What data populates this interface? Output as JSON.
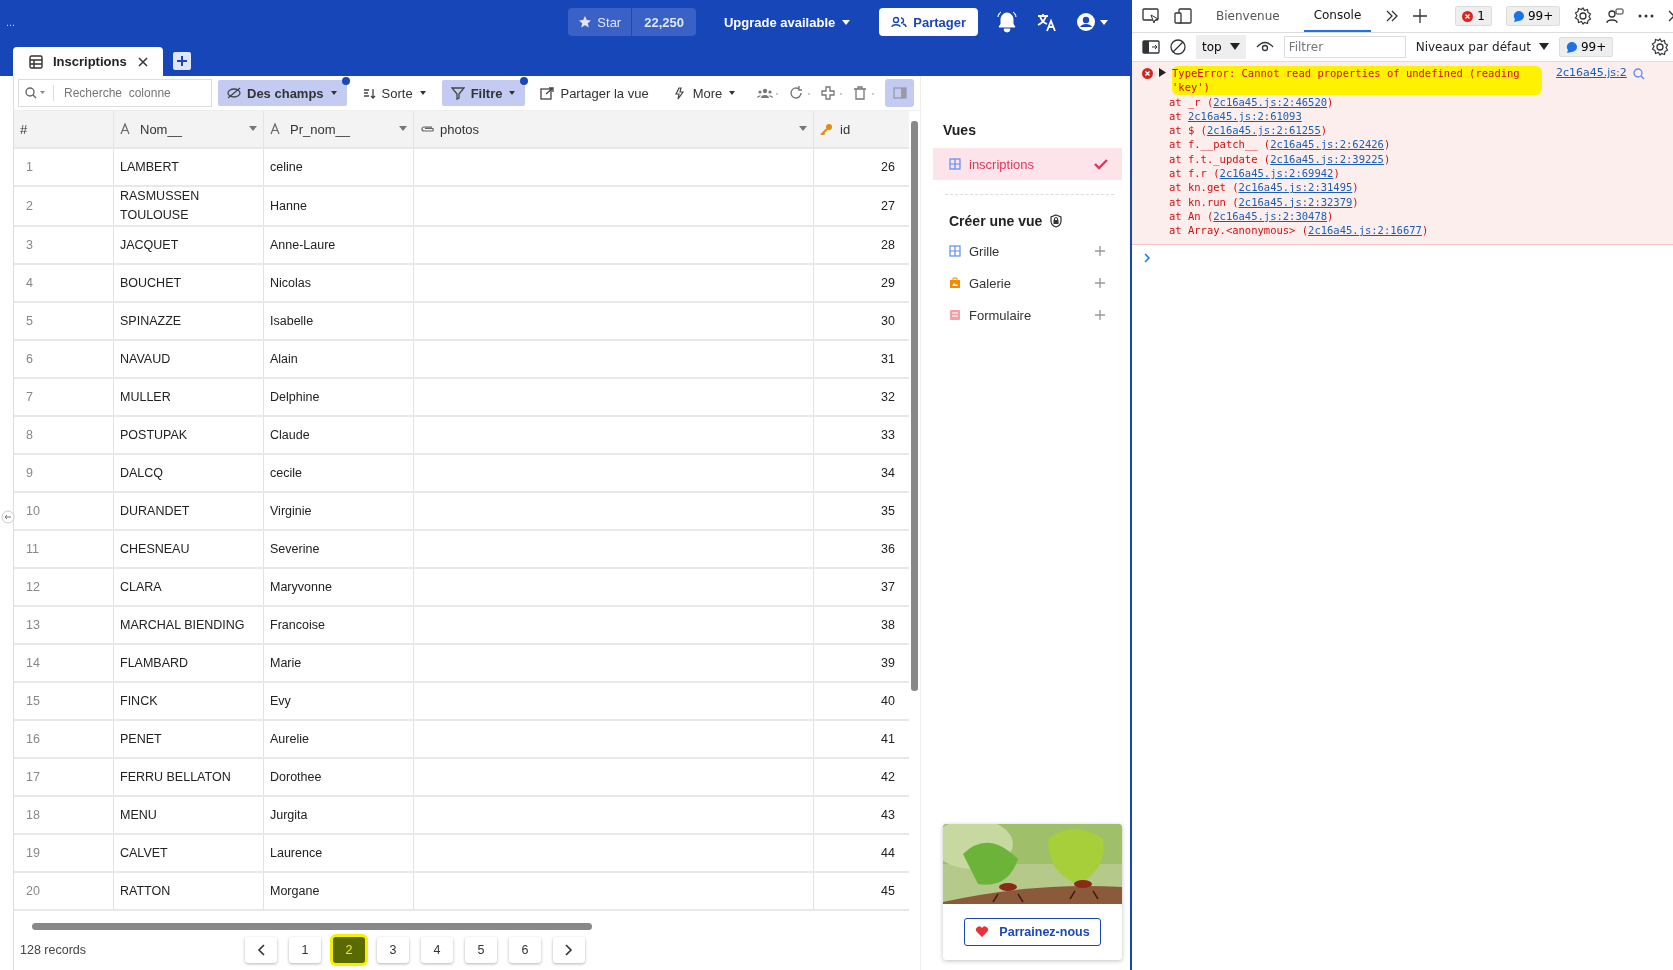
{
  "app": {
    "status_text": "...",
    "star": {
      "label": "Star",
      "count": "22,250"
    },
    "upgrade": "Upgrade available",
    "share": "Partager"
  },
  "tabs": [
    {
      "label": "Inscriptions",
      "selected": true
    }
  ],
  "toolbar": {
    "search": {
      "placeholder": "Recherche  colonne"
    },
    "buttons": [
      {
        "label": "Des champs",
        "kind": "fields",
        "active": true,
        "badge": true
      },
      {
        "label": "Sorte",
        "kind": "sort",
        "active": false,
        "badge": false
      },
      {
        "label": "Filtre",
        "kind": "filter",
        "active": true,
        "badge": true
      },
      {
        "label": "Partager la vue",
        "kind": "share",
        "active": false,
        "badge": false
      },
      {
        "label": "More",
        "kind": "more",
        "active": false,
        "badge": false
      }
    ]
  },
  "table": {
    "columns": [
      {
        "label": "#",
        "kind": "index"
      },
      {
        "label": "Nom__",
        "kind": "text"
      },
      {
        "label": "Pr_nom__",
        "kind": "text"
      },
      {
        "label": "photos",
        "kind": "attachment"
      },
      {
        "label": "id",
        "kind": "key"
      }
    ],
    "rows": [
      {
        "n": "1",
        "nom": "LAMBERT",
        "prenom": "celine",
        "id": "26"
      },
      {
        "n": "2",
        "nom": "RASMUSSEN TOULOUSE",
        "prenom": "Hanne",
        "id": "27"
      },
      {
        "n": "3",
        "nom": "JACQUET",
        "prenom": "Anne-Laure",
        "id": "28"
      },
      {
        "n": "4",
        "nom": "BOUCHET",
        "prenom": "Nicolas",
        "id": "29"
      },
      {
        "n": "5",
        "nom": "SPINAZZE",
        "prenom": "Isabelle",
        "id": "30"
      },
      {
        "n": "6",
        "nom": "NAVAUD",
        "prenom": "Alain",
        "id": "31"
      },
      {
        "n": "7",
        "nom": "MULLER",
        "prenom": "Delphine",
        "id": "32"
      },
      {
        "n": "8",
        "nom": "POSTUPAK",
        "prenom": "Claude",
        "id": "33"
      },
      {
        "n": "9",
        "nom": "DALCQ",
        "prenom": "cecile",
        "id": "34"
      },
      {
        "n": "10",
        "nom": "DURANDET",
        "prenom": "Virginie",
        "id": "35"
      },
      {
        "n": "11",
        "nom": "CHESNEAU",
        "prenom": "Severine",
        "id": "36"
      },
      {
        "n": "12",
        "nom": "CLARA",
        "prenom": "Maryvonne",
        "id": "37"
      },
      {
        "n": "13",
        "nom": "MARCHAL BIENDING",
        "prenom": "Francoise",
        "id": "38"
      },
      {
        "n": "14",
        "nom": "FLAMBARD",
        "prenom": "Marie",
        "id": "39"
      },
      {
        "n": "15",
        "nom": "FINCK",
        "prenom": "Evy",
        "id": "40"
      },
      {
        "n": "16",
        "nom": "PENET",
        "prenom": "Aurelie",
        "id": "41"
      },
      {
        "n": "17",
        "nom": "FERRU BELLATON",
        "prenom": "Dorothee",
        "id": "42"
      },
      {
        "n": "18",
        "nom": "MENU",
        "prenom": "Jurgita",
        "id": "43"
      },
      {
        "n": "19",
        "nom": "CALVET",
        "prenom": "Laurence",
        "id": "44"
      },
      {
        "n": "20",
        "nom": "RATTON",
        "prenom": "Morgane",
        "id": "45"
      }
    ]
  },
  "footer": {
    "records": "128 records",
    "pages": [
      {
        "label": "1",
        "selected": false
      },
      {
        "label": "2",
        "selected": true
      },
      {
        "label": "3",
        "selected": false
      },
      {
        "label": "4",
        "selected": false
      },
      {
        "label": "5",
        "selected": false
      },
      {
        "label": "6",
        "selected": false
      }
    ]
  },
  "sidebar": {
    "title": "Vues",
    "views": [
      {
        "label": "inscriptions",
        "selected": true
      }
    ],
    "create_title": "Créer une vue",
    "create_items": [
      {
        "label": "Grille",
        "kind": "grid"
      },
      {
        "label": "Galerie",
        "kind": "gallery"
      },
      {
        "label": "Formulaire",
        "kind": "form"
      }
    ],
    "sponsor": {
      "button": "Parrainez-nous"
    }
  },
  "devtools": {
    "tabs": [
      {
        "label": "Bienvenue",
        "selected": false
      },
      {
        "label": "Console",
        "selected": true
      }
    ],
    "error_count": "1",
    "message_count": "99+",
    "context": "top",
    "filter": {
      "placeholder": "Filtrer"
    },
    "levels": "Niveaux par défaut",
    "issues_count": "99+",
    "error": {
      "message": "TypeError: Cannot read properties of undefined (reading 'key')",
      "source": "2c16a45.js:2",
      "highlighted": true,
      "stack": [
        {
          "prefix": "at _r (",
          "link": "2c16a45.js:2:46520",
          "suffix": ")"
        },
        {
          "prefix": "at ",
          "link": "2c16a45.js:2:61093"
        },
        {
          "prefix": "at $ (",
          "link": "2c16a45.js:2:61255",
          "suffix": ")"
        },
        {
          "prefix": "at f.__patch__ (",
          "link": "2c16a45.js:2:62426",
          "suffix": ")"
        },
        {
          "prefix": "at f.t._update (",
          "link": "2c16a45.js:2:39225",
          "suffix": ")"
        },
        {
          "prefix": "at f.r (",
          "link": "2c16a45.js:2:69942",
          "suffix": ")"
        },
        {
          "prefix": "at kn.get (",
          "link": "2c16a45.js:2:31495",
          "suffix": ")"
        },
        {
          "prefix": "at kn.run (",
          "link": "2c16a45.js:2:32379",
          "suffix": ")"
        },
        {
          "prefix": "at An (",
          "link": "2c16a45.js:2:30478",
          "suffix": ")"
        },
        {
          "prefix": "at Array.<anonymous> (",
          "link": "2c16a45.js:2:16677",
          "suffix": ")"
        }
      ]
    }
  }
}
